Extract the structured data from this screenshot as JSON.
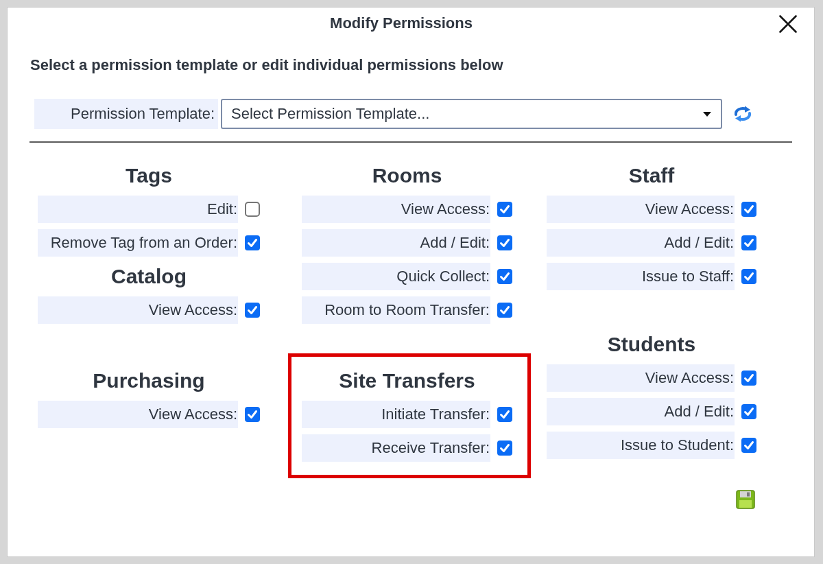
{
  "dialog": {
    "title": "Modify Permissions",
    "instruction": "Select a permission template or edit individual permissions below"
  },
  "template": {
    "label": "Permission Template:",
    "value": "Select Permission Template..."
  },
  "permission_grid": [
    {
      "cells": [
        {
          "sections": [
            {
              "title": "Tags",
              "highlighted": false,
              "permissions": [
                {
                  "label": "Edit:",
                  "checked": false
                },
                {
                  "label": "Remove Tag from an Order:",
                  "checked": true
                }
              ]
            },
            {
              "title": "Catalog",
              "highlighted": false,
              "permissions": [
                {
                  "label": "View Access:",
                  "checked": true
                }
              ]
            }
          ]
        },
        {
          "sections": [
            {
              "title": "Rooms",
              "highlighted": false,
              "permissions": [
                {
                  "label": "View Access:",
                  "checked": true
                },
                {
                  "label": "Add / Edit:",
                  "checked": true
                },
                {
                  "label": "Quick Collect:",
                  "checked": true
                },
                {
                  "label": "Room to Room Transfer:",
                  "checked": true
                }
              ]
            }
          ]
        },
        {
          "sections": [
            {
              "title": "Staff",
              "highlighted": false,
              "permissions": [
                {
                  "label": "View Access:",
                  "checked": true
                },
                {
                  "label": "Add / Edit:",
                  "checked": true
                },
                {
                  "label": "Issue to Staff:",
                  "checked": true
                }
              ]
            }
          ]
        }
      ]
    },
    {
      "cells": [
        {
          "sections": [
            {
              "title": "Purchasing",
              "highlighted": false,
              "permissions": [
                {
                  "label": "View Access:",
                  "checked": true
                }
              ]
            }
          ]
        },
        {
          "sections": [
            {
              "title": "Site Transfers",
              "highlighted": true,
              "permissions": [
                {
                  "label": "Initiate Transfer:",
                  "checked": true
                },
                {
                  "label": "Receive Transfer:",
                  "checked": true
                }
              ]
            }
          ]
        },
        {
          "sections": [
            {
              "title": "Students",
              "highlighted": false,
              "permissions": [
                {
                  "label": "View Access:",
                  "checked": true
                },
                {
                  "label": "Add / Edit:",
                  "checked": true
                },
                {
                  "label": "Issue to Student:",
                  "checked": true
                }
              ]
            }
          ]
        }
      ]
    }
  ]
}
